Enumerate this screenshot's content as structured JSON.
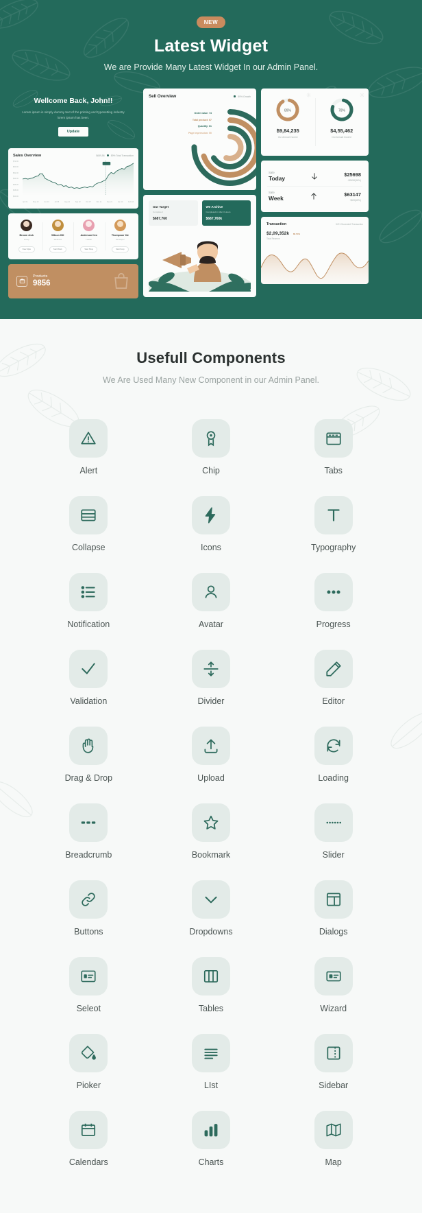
{
  "hero": {
    "badge": "NEW",
    "title": "Latest Widget",
    "subtitle": "We are Provide Many Latest Widget In our Admin Panel.",
    "accent_green": "#236a5b",
    "accent_orange": "#c08f62"
  },
  "dashboard": {
    "welcome": {
      "title": "Wellcome Back, John!!",
      "text": "Lorem ipsum is simply dummy text of the printing and typesetting industry lorem ipsum has been.",
      "button": "Update"
    },
    "sales": {
      "title": "Sales Overview",
      "legend": "$659,56",
      "legend2": "89% Total Transaction",
      "y_ticks": [
        "$72.00",
        "$60.00",
        "$52.00",
        "$44.00",
        "$36.00",
        "$28.00",
        "$20.00"
      ],
      "x_ticks": [
        "Apr 01",
        "May 12",
        "Jun 13",
        "Jul 05",
        "Aug 14",
        "Sep 22",
        "Oct 07",
        "Nov 11",
        "Dec 21",
        "Jan 14",
        "Feb 03"
      ],
      "marker": "$67.44"
    },
    "avatars": [
      {
        "name": "Broom Jeck",
        "role": "Group",
        "button": "View Style"
      },
      {
        "name": "Wilson Hill",
        "role": "Webcord",
        "button": "Start Work"
      },
      {
        "name": "Anderson Ken",
        "role": "Leader",
        "button": "Start Shop"
      },
      {
        "name": "Thompson Yat",
        "role": "Developer",
        "button": "Start Scop"
      }
    ],
    "products": {
      "label": "Products",
      "value": "9856",
      "icon": "box-icon"
    },
    "sell_overview": {
      "title": "Sell Overview",
      "growth": "89% Growth",
      "rows": [
        {
          "label": "Order value: 74",
          "value": 74
        },
        {
          "label": "Total product: 67",
          "value": 67
        },
        {
          "label": "Quantity: 61",
          "value": 61
        },
        {
          "label": "Page Impression: 50",
          "value": 50
        }
      ]
    },
    "target": {
      "left": {
        "title": "Our Target",
        "sub": "Completed",
        "value": "$687,760"
      },
      "right": {
        "title": "We Archive",
        "sub": "Completed in After 3 Hours",
        "value": "$687,760k"
      }
    },
    "income": [
      {
        "percent": "89%",
        "value": "$9,84,235",
        "label": "Our Annual Income"
      },
      {
        "percent": "78%",
        "value": "$4,55,462",
        "label": "Our Annual Income"
      }
    ],
    "sales_rows": [
      {
        "period_label": "Sale",
        "period": "Today",
        "direction": "down",
        "amount": "$25698",
        "delta": "-$2658(36%)"
      },
      {
        "period_label": "Sale",
        "period": "Week",
        "direction": "up",
        "amount": "$63147",
        "delta": "+$69(65%)"
      }
    ],
    "transaction": {
      "title": "Transaction",
      "sub": "5474 Sucessfull Transaction",
      "value": "$2,09,352k",
      "badge": "86.54%",
      "label": "Total Reserve"
    }
  },
  "components": {
    "title": "Usefull Components",
    "subtitle": "We Are Used Many New Component in our Admin Panel.",
    "items": [
      {
        "label": "Alert",
        "icon": "alert-triangle-icon"
      },
      {
        "label": "Chip",
        "icon": "badge-ribbon-icon"
      },
      {
        "label": "Tabs",
        "icon": "browser-window-icon"
      },
      {
        "label": "Collapse",
        "icon": "collapse-panels-icon"
      },
      {
        "label": "Icons",
        "icon": "lightning-bolt-icon"
      },
      {
        "label": "Typography",
        "icon": "text-t-icon"
      },
      {
        "label": "Notification",
        "icon": "list-lines-icon"
      },
      {
        "label": "Avatar",
        "icon": "person-icon"
      },
      {
        "label": "Progress",
        "icon": "three-dots-icon"
      },
      {
        "label": "Validation",
        "icon": "check-mark-icon"
      },
      {
        "label": "Divider",
        "icon": "up-down-arrows-icon"
      },
      {
        "label": "Editor",
        "icon": "pencil-icon"
      },
      {
        "label": "Drag & Drop",
        "icon": "hand-icon"
      },
      {
        "label": "Upload",
        "icon": "upload-icon"
      },
      {
        "label": "Loading",
        "icon": "refresh-circle-icon"
      },
      {
        "label": "Breadcrumb",
        "icon": "dashes-icon"
      },
      {
        "label": "Bookmark",
        "icon": "star-icon"
      },
      {
        "label": "Slider",
        "icon": "dotted-line-icon"
      },
      {
        "label": "Buttons",
        "icon": "link-chain-icon"
      },
      {
        "label": "Dropdowns",
        "icon": "chevron-down-icon"
      },
      {
        "label": "Dialogs",
        "icon": "window-split-icon"
      },
      {
        "label": "Seleot",
        "icon": "select-list-icon"
      },
      {
        "label": "Tables",
        "icon": "columns-icon"
      },
      {
        "label": "Wizard",
        "icon": "card-text-icon"
      },
      {
        "label": "Pioker",
        "icon": "paint-bucket-icon"
      },
      {
        "label": "LIst",
        "icon": "lines-icon"
      },
      {
        "label": "Sidebar",
        "icon": "sidebar-icon"
      },
      {
        "label": "Calendars",
        "icon": "calendar-icon"
      },
      {
        "label": "Charts",
        "icon": "bar-chart-icon"
      },
      {
        "label": "Map",
        "icon": "map-icon"
      }
    ]
  }
}
